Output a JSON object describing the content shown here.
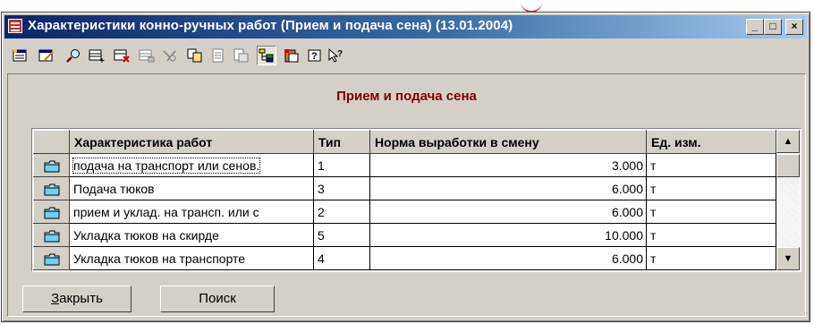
{
  "window": {
    "title": "Характеристики конно-ручных работ (Прием и подача сена) (13.01.2004)",
    "controls": {
      "minimize": "_",
      "maximize": "□",
      "close": "×"
    }
  },
  "toolbar": {
    "icons": [
      "new-record-icon",
      "edit-record-icon",
      "search-icon",
      "add-row-icon",
      "delete-row-icon",
      "print-icon",
      "filter-icon",
      "copy-icon",
      "properties-icon",
      "export-icon",
      "tree-view-icon",
      "paste-icon",
      "help-icon",
      "context-help-icon"
    ]
  },
  "panel": {
    "title": "Прием и подача сена"
  },
  "grid": {
    "columns": [
      "Характеристика работ",
      "Тип",
      "Норма выработки в смену",
      "Ед. изм."
    ],
    "rows": [
      {
        "name": "подача на транспорт или сенов.",
        "type": "1",
        "norm": "3.000",
        "unit": "т"
      },
      {
        "name": "Подача тюков",
        "type": "3",
        "norm": "6.000",
        "unit": "т"
      },
      {
        "name": "прием и уклад. на трансп. или с",
        "type": "2",
        "norm": "6.000",
        "unit": "т"
      },
      {
        "name": "Укладка тюков на скирде",
        "type": "5",
        "norm": "10.000",
        "unit": "т"
      },
      {
        "name": "Укладка тюков на транспорте",
        "type": "4",
        "norm": "6.000",
        "unit": "т"
      }
    ],
    "scroll_up": "▲",
    "scroll_down": "▼"
  },
  "buttons": {
    "close_hotkey": "З",
    "close_rest": "акрыть",
    "search": "Поиск"
  },
  "colors": {
    "title_start": "#0a246a",
    "title_end": "#a6caf0",
    "panel_title": "#800000",
    "face": "#d4d0c8"
  }
}
